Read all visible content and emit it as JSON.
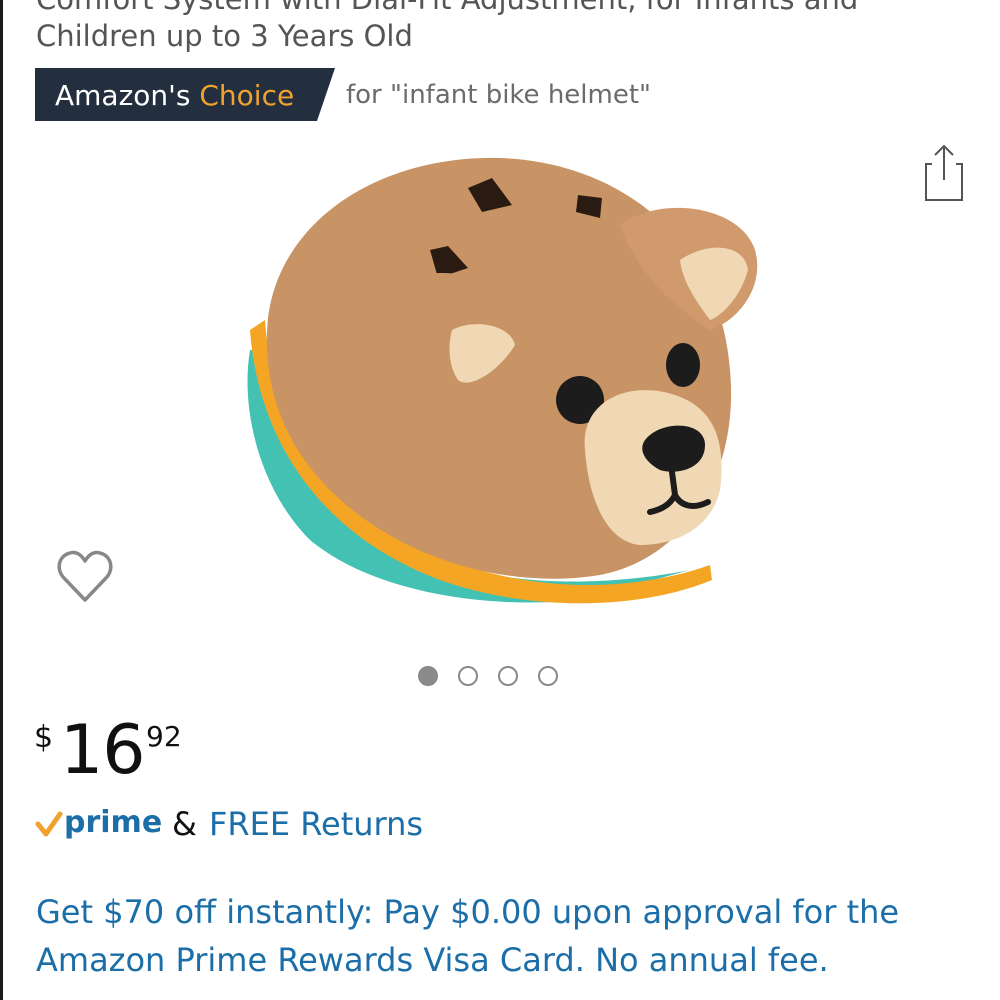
{
  "product": {
    "title_line1": "Comfort System with Dial-Fit Adjustment, for Infants and",
    "title_line2": "Children up to 3 Years Old"
  },
  "badge": {
    "label_primary": "Amazon's",
    "label_accent": "Choice",
    "context": "for \"infant bike helmet\"",
    "background_color": "#232f3e",
    "accent_color": "#f0a22e"
  },
  "icons": {
    "share": "share-icon",
    "wishlist": "heart-outline-icon"
  },
  "carousel": {
    "total": 4,
    "active_index": 0
  },
  "price": {
    "currency_symbol": "$",
    "whole": "16",
    "fraction": "92"
  },
  "shipping": {
    "prime_label": "prime",
    "ampersand": "&",
    "free_returns": "FREE Returns"
  },
  "promo": {
    "text": "Get $70 off instantly: Pay $0.00 upon approval for the Amazon Prime Rewards Visa Card. No annual fee."
  },
  "colors": {
    "link": "#1b6ea8",
    "prime_blue": "#1b6ea8",
    "prime_check": "#f0a22e"
  }
}
